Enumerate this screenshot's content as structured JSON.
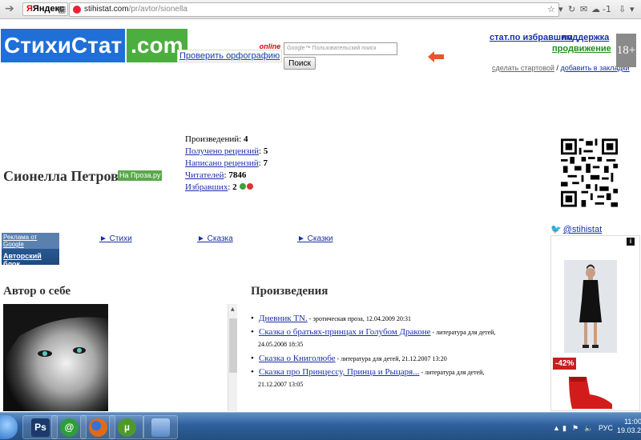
{
  "browser": {
    "logo": "Яндекс",
    "url_host": "stihistat.com",
    "url_path": "/pr/avtor/sionella",
    "right_counter": "-1"
  },
  "header": {
    "logo_part1": "СтихиСтат",
    "logo_part2": ".com",
    "spellcheck_label": "Проверить орфографию",
    "spellcheck_tag": "online",
    "search_placeholder": "Пользовательский поиск",
    "search_brand": "Google",
    "search_button": "Поиск",
    "link_favorites": "стат.по избравшим",
    "link_support": "поддержка",
    "link_promo": "продвижение",
    "link_homepage": "сделать стартовой",
    "separator": "/",
    "link_bookmarks": "добавить в закладки",
    "age_badge": "18+"
  },
  "author": {
    "name": "Сионелла Петрова",
    "proza_badge": "На Проза.ру",
    "stats": [
      {
        "label": "Произведений",
        "value": "4",
        "link": false
      },
      {
        "label": "Получено рецензий",
        "value": "5",
        "link": true
      },
      {
        "label": "Написано рецензий",
        "value": "7",
        "link": true
      },
      {
        "label": "Читателей",
        "value": "7846",
        "link": true
      },
      {
        "label": "Избравших",
        "value": "2",
        "link": true
      }
    ]
  },
  "ads": {
    "google_title": "Реклама от Google",
    "google_item": "Авторский блок",
    "links": [
      "► Стихи",
      "► Сказка",
      "► Сказки"
    ],
    "twitter_handle": "@stihistat",
    "discount": "-42%",
    "info": "i"
  },
  "about": {
    "title": "Автор о себе"
  },
  "works": {
    "title": "Произведения",
    "items": [
      {
        "title": "Дневник TN.",
        "meta": " - эротическая проза, 12.04.2009 20:31",
        "meta2": ""
      },
      {
        "title": "Сказка о братьях-принцах и Голубом Драконе",
        "meta": " - литература для детей,",
        "meta2": "24.05.2008 18:35"
      },
      {
        "title": "Сказка о Книголюбе",
        "meta": " - литература для детей, 21.12.2007 13:20",
        "meta2": ""
      },
      {
        "title": "Сказка про Принцессу, Принца и Рыцаря...",
        "meta": " - литература для детей,",
        "meta2": "21.12.2007 13:05"
      }
    ]
  },
  "taskbar": {
    "apps": [
      {
        "name": "photoshop",
        "label": "Ps",
        "color": "#1b3a6b"
      },
      {
        "name": "mail-agent",
        "label": "@",
        "color": "#2f9d3a"
      },
      {
        "name": "firefox",
        "label": "",
        "color": "#e36a12"
      },
      {
        "name": "utorrent",
        "label": "µ",
        "color": "#4c9a2a"
      },
      {
        "name": "notes",
        "label": "",
        "color": "#6d9ed8"
      }
    ],
    "lang": "РУС",
    "time": "11:00",
    "date": "19.03.201"
  }
}
